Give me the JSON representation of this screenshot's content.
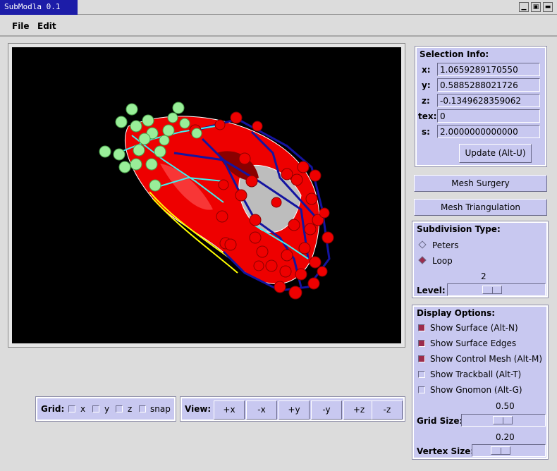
{
  "window": {
    "title": "SubModla 0.1",
    "controls": [
      "minimize",
      "maximize",
      "close"
    ]
  },
  "menu": {
    "file": "File",
    "edit": "Edit"
  },
  "selection": {
    "heading": "Selection Info:",
    "x_label": "x:",
    "x": "1.0659289170550",
    "y_label": "y:",
    "y": "0.5885288021726",
    "z_label": "z:",
    "z": "-0.1349628359062",
    "tex_label": "tex:",
    "tex": "0",
    "s_label": "s:",
    "s": "2.0000000000000",
    "update": "Update (Alt-U)"
  },
  "mesh_surgery": "Mesh Surgery",
  "mesh_triangulation": "Mesh Triangulation",
  "subdivision": {
    "heading": "Subdivision Type:",
    "options": [
      "Peters",
      "Loop"
    ],
    "selected": "Loop",
    "level_value": "2",
    "level_label": "Level:",
    "level_fraction": 0.45
  },
  "display": {
    "heading": "Display Options:",
    "options": [
      {
        "label": "Show Surface (Alt-N)",
        "checked": true
      },
      {
        "label": "Show Surface Edges",
        "checked": true
      },
      {
        "label": "Show Control Mesh (Alt-M)",
        "checked": true
      },
      {
        "label": "Show Trackball (Alt-T)",
        "checked": false
      },
      {
        "label": "Show Gnomon (Alt-G)",
        "checked": false
      }
    ],
    "grid_size_value": "0.50",
    "grid_size_label": "Grid Size:",
    "grid_size_fraction": 0.5,
    "vertex_size_value": "0.20",
    "vertex_size_label": "Vertex Size:",
    "vertex_size_fraction": 0.35
  },
  "grid": {
    "label": "Grid:",
    "options": [
      {
        "label": "x",
        "checked": false
      },
      {
        "label": "y",
        "checked": false
      },
      {
        "label": "z",
        "checked": false
      },
      {
        "label": "snap",
        "checked": false
      }
    ]
  },
  "view": {
    "label": "View:",
    "buttons": [
      "+x",
      "-x",
      "+y",
      "-y",
      "+z",
      "-z"
    ]
  },
  "colors": {
    "accent": "#c8c8f0",
    "checked": "#9c2c4c",
    "title_bar": "#1c1ca8",
    "viewport_bg": "#000000",
    "surface": "#ee0000",
    "control_points": "#99ee99",
    "control_mesh": "#000080"
  }
}
